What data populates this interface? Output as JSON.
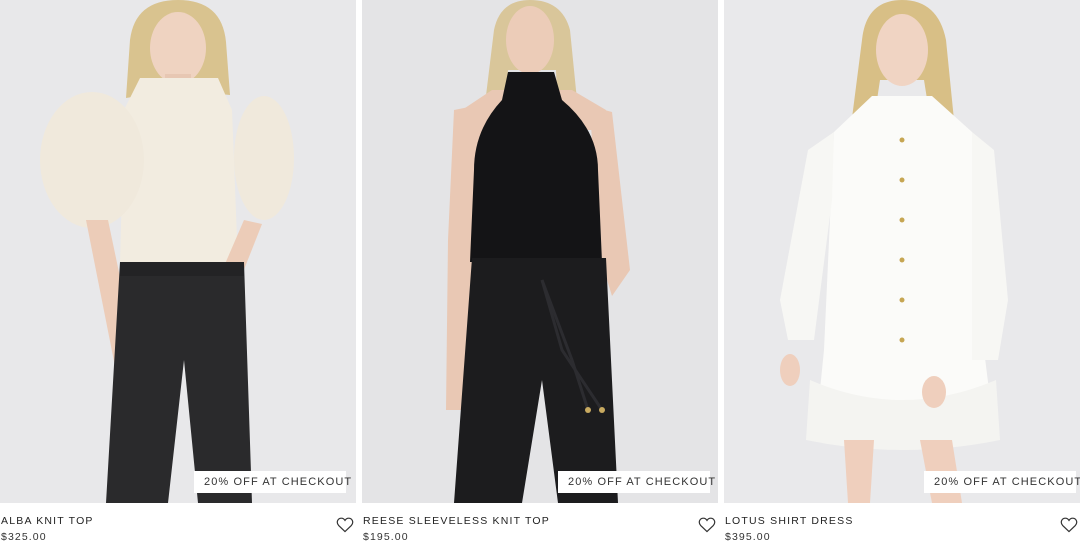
{
  "products": [
    {
      "name": "ALBA KNIT TOP",
      "price": "$325.00",
      "promo": "20% OFF AT CHECKOUT",
      "wishlist_icon": "heart-outline-icon",
      "colors": {
        "top": "#f2ece0",
        "bottom": "#2a2a2c",
        "background": "#e8e8ea"
      }
    },
    {
      "name": "REESE SLEEVELESS KNIT TOP",
      "price": "$195.00",
      "promo": "20% OFF AT CHECKOUT",
      "wishlist_icon": "heart-outline-icon",
      "colors": {
        "top": "#141416",
        "bottom": "#1c1c1e",
        "background": "#e4e4e6"
      }
    },
    {
      "name": "LOTUS SHIRT DRESS",
      "price": "$395.00",
      "promo": "20% OFF AT CHECKOUT",
      "wishlist_icon": "heart-outline-icon",
      "colors": {
        "top": "#fbfbf9",
        "bottom": "#fbfbf9",
        "background": "#e9e9eb"
      }
    }
  ]
}
